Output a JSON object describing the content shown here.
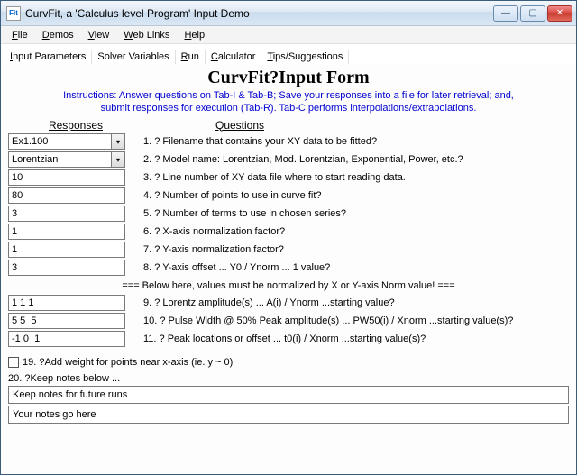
{
  "titlebar": {
    "icon_text": "Fit",
    "title": "CurvFit, a 'Calculus level Program' Input Demo"
  },
  "menu": {
    "file": "File",
    "demos": "Demos",
    "view": "View",
    "weblinks": "Web Links",
    "help": "Help"
  },
  "tabs": {
    "input_params": "Input Parameters",
    "solver_vars": "Solver Variables",
    "run": "Run",
    "calculator": "Calculator",
    "tips": "Tips/Suggestions"
  },
  "form": {
    "title": "CurvFit?Input Form",
    "instructions_l1": "Instructions: Answer questions on Tab-I & Tab-B; Save your responses into a file for later retrieval; and,",
    "instructions_l2": "submit responses for execution (Tab-R). Tab-C performs interpolations/extrapolations.",
    "header_responses": "Responses",
    "header_questions": "Questions",
    "rows": [
      {
        "value": "Ex1.100",
        "type": "combo",
        "q": "1. ? Filename that contains your XY data to be fitted?"
      },
      {
        "value": "Lorentzian",
        "type": "combo",
        "q": "2. ? Model name: Lorentzian, Mod. Lorentzian, Exponential, Power, etc.?"
      },
      {
        "value": "10",
        "type": "text",
        "q": "3. ? Line number of XY data file where to start reading data."
      },
      {
        "value": "80",
        "type": "text",
        "q": "4. ? Number of points to use in curve fit?"
      },
      {
        "value": "3",
        "type": "text",
        "q": "5. ? Number of terms to use in chosen series?"
      },
      {
        "value": "1",
        "type": "text",
        "q": "6. ? X-axis normalization factor?"
      },
      {
        "value": "1",
        "type": "text",
        "q": "7. ? Y-axis normalization factor?"
      },
      {
        "value": "3",
        "type": "text",
        "q": "8. ? Y-axis offset ... Y0 / Ynorm ... 1 value?"
      }
    ],
    "divider_note": "=== Below here, values must be normalized by X or Y-axis Norm value! ===",
    "rows2": [
      {
        "value": "1 1 1",
        "q": "9. ?  Lorentz amplitude(s) ... A(i) / Ynorm ...starting value?"
      },
      {
        "value": "5 5  5",
        "q": "10. ?  Pulse Width @ 50% Peak amplitude(s) ... PW50(i) / Xnorm ...starting value(s)?"
      },
      {
        "value": "-1 0  1",
        "q": "11. ?  Peak locations or offset ... t0(i) / Xnorm ...starting value(s)?"
      }
    ],
    "checkbox_label": "19. ?Add weight for points near x-axis (ie. y ~ 0)",
    "notes_label": "20. ?Keep notes below ...",
    "notes_value1": "Keep notes for future runs",
    "notes_value2": "Your notes go here"
  }
}
